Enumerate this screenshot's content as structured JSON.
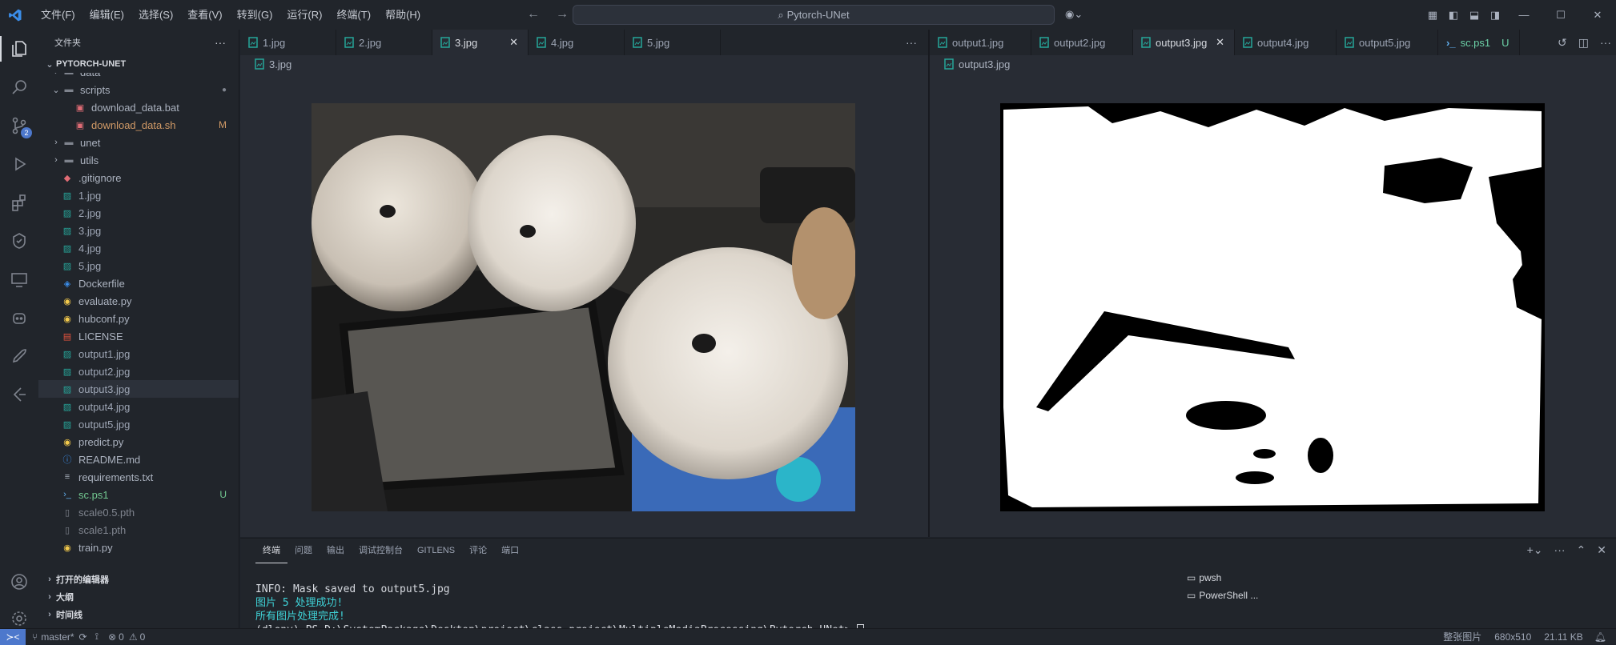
{
  "titlebar": {
    "menu": [
      "文件(F)",
      "编辑(E)",
      "选择(S)",
      "查看(V)",
      "转到(G)",
      "运行(R)",
      "终端(T)",
      "帮助(H)"
    ],
    "command_center": "Pytorch-UNet"
  },
  "activitybar": {
    "scm_badge": "2"
  },
  "sidebar": {
    "title": "文件夹",
    "root": "PYTORCH-UNET",
    "items": [
      {
        "label": "data",
        "kind": "folder"
      },
      {
        "label": "scripts",
        "kind": "folder-open"
      },
      {
        "label": "download_data.bat",
        "kind": "bat"
      },
      {
        "label": "download_data.sh",
        "kind": "sh",
        "badge": "M"
      },
      {
        "label": "unet",
        "kind": "folder"
      },
      {
        "label": "utils",
        "kind": "folder"
      },
      {
        "label": ".gitignore",
        "kind": "git"
      },
      {
        "label": "1.jpg",
        "kind": "img"
      },
      {
        "label": "2.jpg",
        "kind": "img"
      },
      {
        "label": "3.jpg",
        "kind": "img"
      },
      {
        "label": "4.jpg",
        "kind": "img"
      },
      {
        "label": "5.jpg",
        "kind": "img"
      },
      {
        "label": "Dockerfile",
        "kind": "docker"
      },
      {
        "label": "evaluate.py",
        "kind": "py"
      },
      {
        "label": "hubconf.py",
        "kind": "py"
      },
      {
        "label": "LICENSE",
        "kind": "license"
      },
      {
        "label": "output1.jpg",
        "kind": "img"
      },
      {
        "label": "output2.jpg",
        "kind": "img"
      },
      {
        "label": "output3.jpg",
        "kind": "img"
      },
      {
        "label": "output4.jpg",
        "kind": "img"
      },
      {
        "label": "output5.jpg",
        "kind": "img"
      },
      {
        "label": "predict.py",
        "kind": "py"
      },
      {
        "label": "README.md",
        "kind": "info"
      },
      {
        "label": "requirements.txt",
        "kind": "txt"
      },
      {
        "label": "sc.ps1",
        "kind": "ps",
        "badge": "U"
      },
      {
        "label": "scale0.5.pth",
        "kind": "file"
      },
      {
        "label": "scale1.pth",
        "kind": "file"
      },
      {
        "label": "train.py",
        "kind": "py"
      }
    ],
    "sections": [
      "打开的编辑器",
      "大纲",
      "时间线"
    ]
  },
  "editor_left": {
    "tabs": [
      "1.jpg",
      "2.jpg",
      "3.jpg",
      "4.jpg",
      "5.jpg"
    ],
    "active_tab": "3.jpg",
    "breadcrumb": "3.jpg"
  },
  "editor_right": {
    "tabs": [
      "output1.jpg",
      "output2.jpg",
      "output3.jpg",
      "output4.jpg",
      "output5.jpg",
      "sc.ps1"
    ],
    "active_tab": "output3.jpg",
    "sc_badge": "U",
    "breadcrumb": "output3.jpg"
  },
  "panel": {
    "tabs": [
      "终端",
      "问题",
      "输出",
      "调试控制台",
      "GITLENS",
      "评论",
      "端口"
    ],
    "terminal_lines": [
      "INFO: Mask saved to output5.jpg",
      "图片 5 处理成功!",
      "所有图片处理完成!",
      "(dlenv) PS D:\\SystemPackage\\Desktop\\project\\class_project\\MultipleMediaProcessing\\Pytorch-UNet> "
    ],
    "terminals": [
      "pwsh",
      "PowerShell ..."
    ]
  },
  "statusbar": {
    "branch": "master*",
    "errors": "0",
    "warnings": "0",
    "viewer": "整张图片",
    "dimensions": "680x510",
    "size": "21.11 KB"
  }
}
